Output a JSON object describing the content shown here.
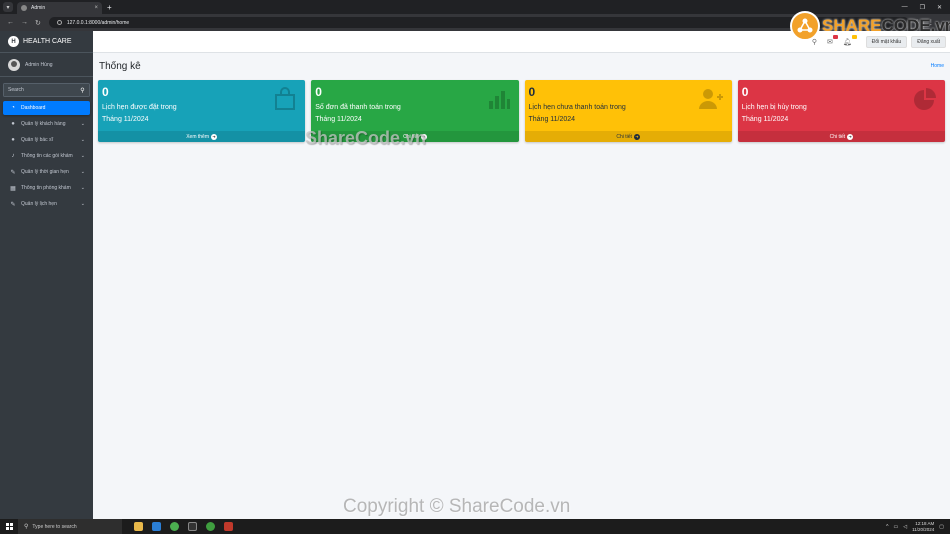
{
  "browser": {
    "tab_title": "Admin",
    "url": "127.0.0.1:8000/admin/home",
    "new_tab": "+"
  },
  "sidebar": {
    "brand": "HEALTH CARE",
    "user_name": "Admin Hùng",
    "search_placeholder": "Search",
    "items": [
      {
        "label": "Dashboard",
        "icon": "tachometer-icon",
        "active": true
      },
      {
        "label": "Quản lý khách hàng",
        "icon": "users-icon"
      },
      {
        "label": "Quản lý bác sĩ",
        "icon": "doctor-icon"
      },
      {
        "label": "Thông tin các gói khám",
        "icon": "bell-icon"
      },
      {
        "label": "Quản lý thời gian hẹn",
        "icon": "edit-icon"
      },
      {
        "label": "Thông tin phòng khám",
        "icon": "table-icon"
      },
      {
        "label": "Quản lý lịch hẹn",
        "icon": "edit-icon"
      }
    ]
  },
  "navbar": {
    "change_password": "Đổi mật khẩu",
    "logout": "Đăng xuất"
  },
  "content": {
    "title": "Thống kê",
    "breadcrumb": "Home"
  },
  "boxes": [
    {
      "count": "0",
      "label": "Lịch hẹn được đặt trong",
      "month": "Tháng 11/2024",
      "footer": "Xem thêm",
      "color": "#17a2b8",
      "icon": "shopping-bag-icon"
    },
    {
      "count": "0",
      "label": "Số đơn đã thanh toán trong",
      "month": "Tháng 11/2024",
      "footer": "Chi tiết",
      "color": "#28a745",
      "icon": "bar-chart-icon"
    },
    {
      "count": "0",
      "label": "Lịch hẹn chưa thanh toán trong",
      "month": "Tháng 11/2024",
      "footer": "Chi tiết",
      "color": "#ffc107",
      "icon": "user-plus-icon"
    },
    {
      "count": "0",
      "label": "Lịch hẹn bị hủy trong",
      "month": "Tháng 11/2024",
      "footer": "Chi tiết",
      "color": "#dc3545",
      "icon": "pie-chart-icon"
    }
  ],
  "watermarks": {
    "logo_prefix": "SHARE",
    "logo_suffix": "CODE.vn",
    "middle": "ShareCode.vn",
    "bottom": "Copyright © ShareCode.vn"
  },
  "taskbar": {
    "search_placeholder": "Type here to search",
    "time": "12:18 AM",
    "date": "11/20/2024"
  }
}
